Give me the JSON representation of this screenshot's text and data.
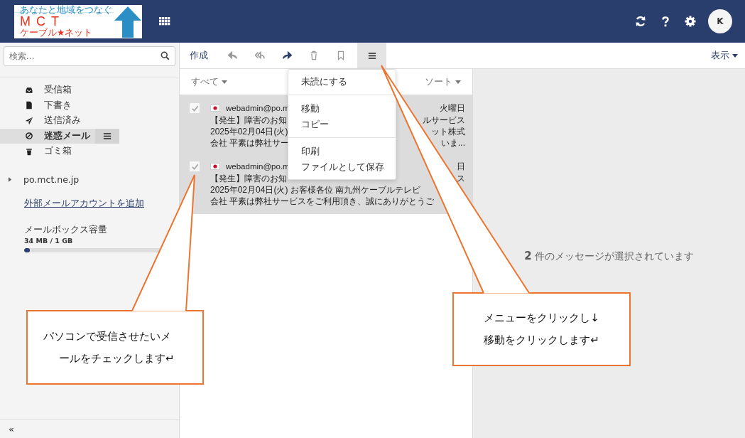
{
  "header": {
    "logo": {
      "tagline": "あなたと地域をつなぐ",
      "name": "MCT",
      "subtitle": "ケーブル★ネット"
    },
    "avatar": "K"
  },
  "search": {
    "placeholder": "検索..."
  },
  "folders": [
    {
      "label": "受信箱",
      "kind": "inbox",
      "selected": false
    },
    {
      "label": "下書き",
      "kind": "draft",
      "selected": false
    },
    {
      "label": "送信済み",
      "kind": "sent",
      "selected": false
    },
    {
      "label": "迷惑メール",
      "kind": "spam",
      "selected": true
    },
    {
      "label": "ゴミ箱",
      "kind": "trash",
      "selected": false
    }
  ],
  "account": {
    "label": "po.mct.ne.jp",
    "expanded": false
  },
  "add_account_link": "外部メールアカウントを追加",
  "quota": {
    "label": "メールボックス容量",
    "reading": "34 MB / 1 GB",
    "level": 0.04
  },
  "collapse_button": "«",
  "toolbar": {
    "compose": "作成",
    "view_button": "表示",
    "menu_open": true
  },
  "list_header": {
    "filter": "すべて",
    "sort": "ソート"
  },
  "messages": [
    {
      "checked": true,
      "sender": "webadmin@po.m",
      "date": "火曜日",
      "lines": [
        {
          "left": "【発生】障害のお知",
          "right": "ルサービス"
        },
        {
          "left": "2025年02月04日(火)",
          "right": "ット株式"
        },
        {
          "left": "会社 平素は弊社サー",
          "right": "いま..."
        }
      ]
    },
    {
      "checked": true,
      "sender": "webadmin@po.m",
      "date": "日",
      "lines": [
        {
          "left": "【発生】障害のお知",
          "right": "ス"
        },
        {
          "left": "2025年02月04日(火) お客様各位 南九州ケーブルテレビ"
        },
        {
          "left": "会社 平素は弊社サービスをご利用頂き、誠にありがとうご"
        }
      ]
    }
  ],
  "menu": [
    [
      "未読にする"
    ],
    [
      "移動",
      "コピー"
    ],
    [
      "印刷",
      "ファイルとして保存"
    ]
  ],
  "selection_info": {
    "count": "2",
    "text": "件のメッセージが選択されています"
  },
  "callouts": [
    {
      "lines": [
        "パソコンで受信させたいメ",
        "ールをチェックします↵"
      ]
    },
    {
      "lines": [
        "メニューをクリックし↓",
        "移動をクリックします↵"
      ]
    }
  ]
}
